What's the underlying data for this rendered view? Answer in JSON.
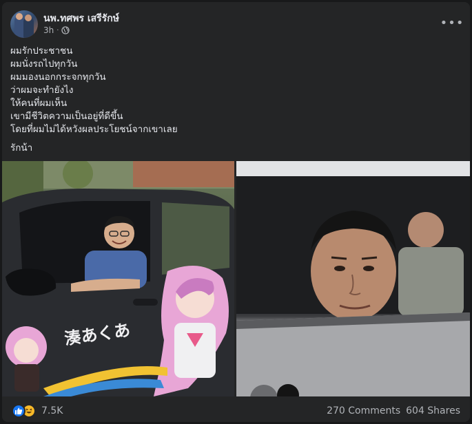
{
  "post": {
    "author": "นพ.ทศพร เสรีรักษ์",
    "timestamp": "3h",
    "privacy_icon": "globe-icon",
    "more_icon": "•••",
    "lines": [
      "ผมรักประชาชน",
      "ผมนั่งรถไปทุกวัน",
      "ผมมองนอกกระจกทุกวัน",
      "ว่าผมจะทำยังไง",
      "ให้คนที่ผมเห็น",
      "เขามีชีวิตความเป็นอยู่ที่ดีขึ้น",
      "โดยที่ผมไม่ได้หวังผลประโยชน์จากเขาเลย"
    ],
    "closing": "รักน้า",
    "car_decal_text": "湊あくあ",
    "reactions": {
      "types": [
        "like-icon",
        "haha-icon"
      ],
      "count": "7.5K"
    },
    "comments": "270 Comments",
    "shares": "604 Shares"
  },
  "colors": {
    "background": "#18191a",
    "card": "#242526",
    "text_primary": "#e4e6eb",
    "text_secondary": "#b0b3b8",
    "like_blue": "#1877f2",
    "haha_yellow": "#f7b928"
  }
}
